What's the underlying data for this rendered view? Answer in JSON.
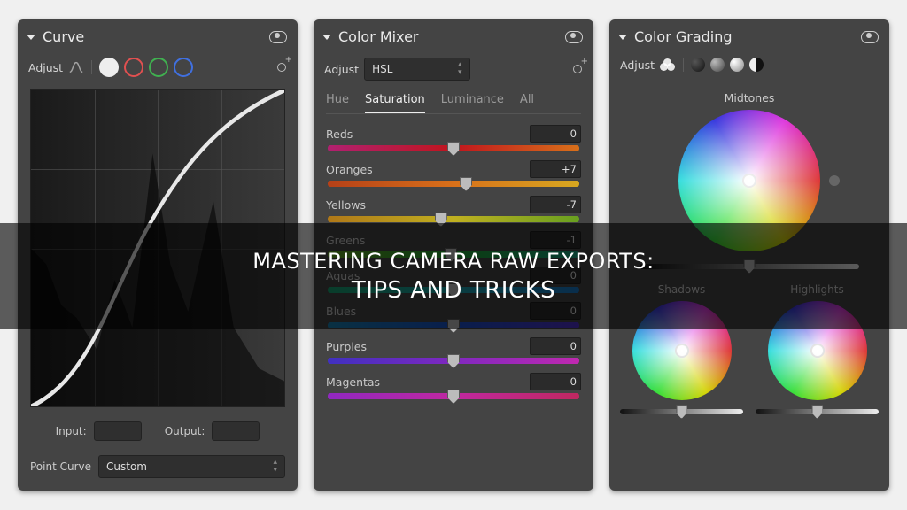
{
  "overlay": {
    "line1": "MASTERING CAMERA RAW EXPORTS:",
    "line2": "TIPS AND TRICKS"
  },
  "curve": {
    "title": "Curve",
    "adjust_label": "Adjust",
    "input_label": "Input:",
    "output_label": "Output:",
    "point_curve_label": "Point Curve",
    "point_curve_value": "Custom"
  },
  "mixer": {
    "title": "Color Mixer",
    "adjust_label": "Adjust",
    "mode": "HSL",
    "tabs": {
      "hue": "Hue",
      "sat": "Saturation",
      "lum": "Luminance",
      "all": "All"
    },
    "active_tab": "Saturation",
    "rows": [
      {
        "name": "Reds",
        "value": "0",
        "pos": 50,
        "grad": "g-red"
      },
      {
        "name": "Oranges",
        "value": "+7",
        "pos": 55,
        "grad": "g-org"
      },
      {
        "name": "Yellows",
        "value": "-7",
        "pos": 45,
        "grad": "g-yel"
      },
      {
        "name": "Greens",
        "value": "-1",
        "pos": 49,
        "grad": "g-grn"
      },
      {
        "name": "Aquas",
        "value": "0",
        "pos": 50,
        "grad": "g-aqu"
      },
      {
        "name": "Blues",
        "value": "0",
        "pos": 50,
        "grad": "g-blu"
      },
      {
        "name": "Purples",
        "value": "0",
        "pos": 50,
        "grad": "g-pur"
      },
      {
        "name": "Magentas",
        "value": "0",
        "pos": 50,
        "grad": "g-mag"
      }
    ]
  },
  "grading": {
    "title": "Color Grading",
    "adjust_label": "Adjust",
    "midtones_label": "Midtones",
    "shadows_label": "Shadows",
    "highlights_label": "Highlights"
  }
}
